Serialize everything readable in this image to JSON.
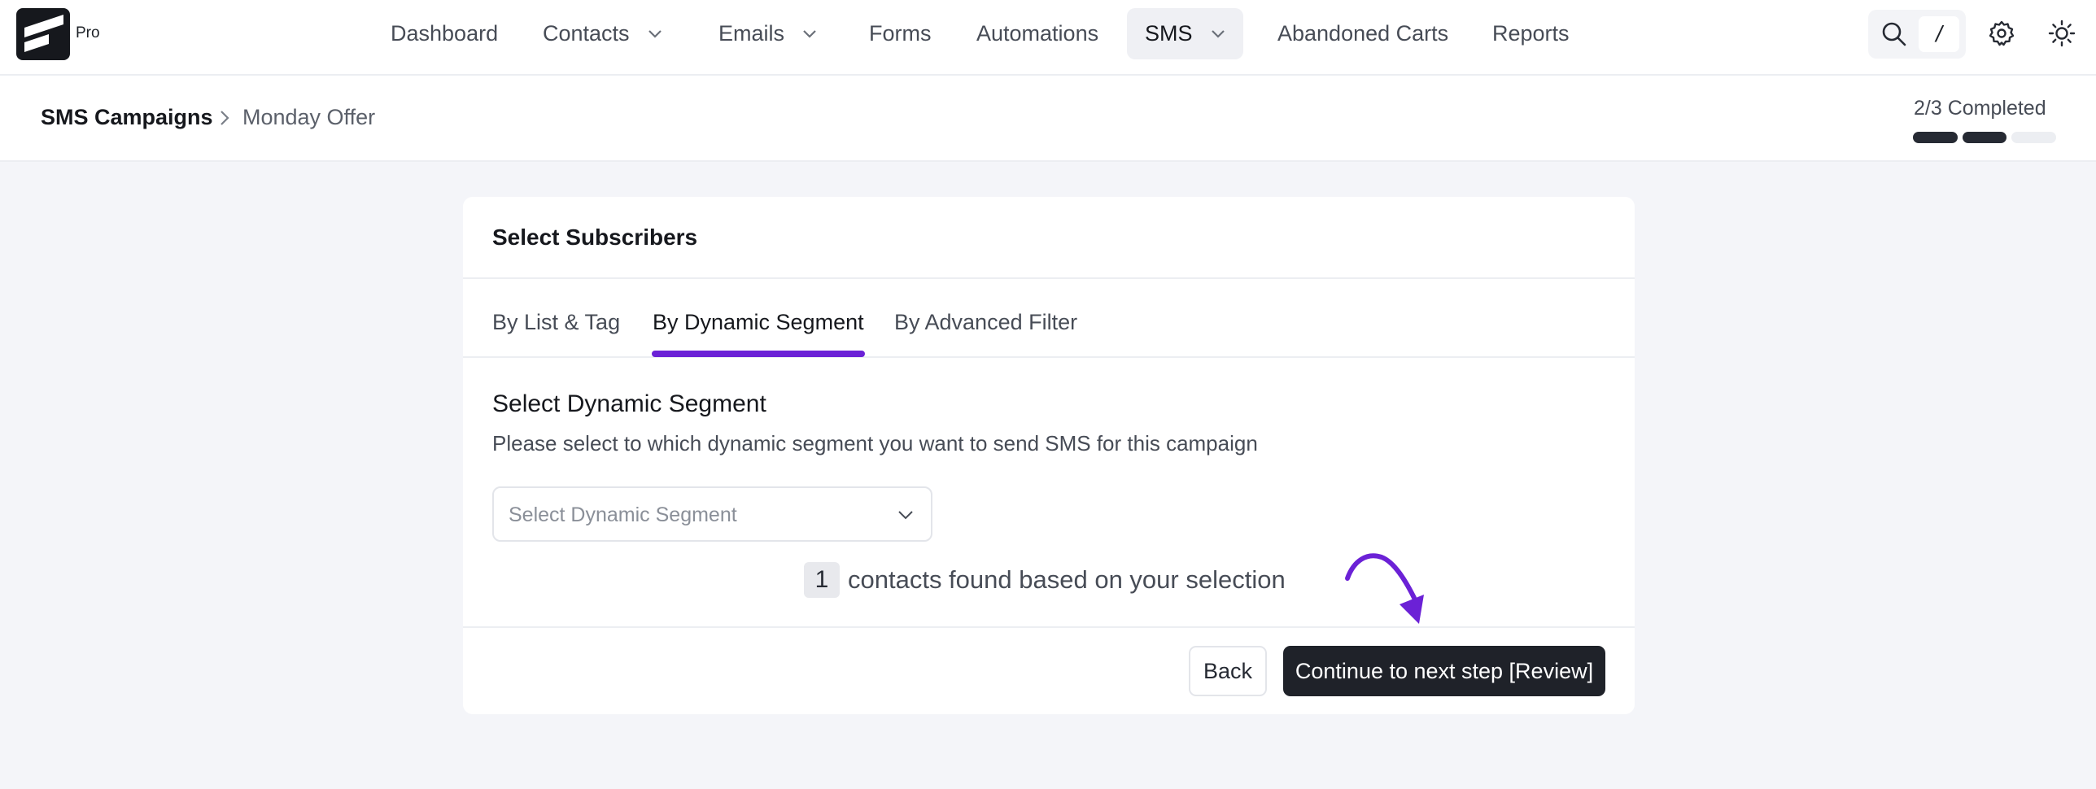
{
  "app": {
    "logo_icon": "fluentcrm-logo-icon",
    "pro_label": "Pro"
  },
  "nav": {
    "items": [
      {
        "label": "Dashboard",
        "dropdown": false
      },
      {
        "label": "Contacts",
        "dropdown": true
      },
      {
        "label": "Emails",
        "dropdown": true
      },
      {
        "label": "Forms",
        "dropdown": false
      },
      {
        "label": "Automations",
        "dropdown": false
      },
      {
        "label": "SMS",
        "dropdown": true,
        "active": true
      },
      {
        "label": "Abandoned Carts",
        "dropdown": false
      },
      {
        "label": "Reports",
        "dropdown": false
      }
    ],
    "search_icon": "search-icon",
    "search_shortcut": "/",
    "settings_icon": "gear-icon",
    "theme_icon": "sun-icon"
  },
  "breadcrumb": {
    "root": "SMS Campaigns",
    "separator_icon": "chevron-right-icon",
    "current": "Monday Offer"
  },
  "progress": {
    "label": "2/3 Completed",
    "completed": 2,
    "total": 3
  },
  "card": {
    "title": "Select Subscribers",
    "tabs": [
      {
        "label": "By List & Tag",
        "active": false
      },
      {
        "label": "By Dynamic Segment",
        "active": true
      },
      {
        "label": "By Advanced Filter",
        "active": false
      }
    ],
    "section_title": "Select Dynamic Segment",
    "section_desc": "Please select to which dynamic segment you want to send SMS for this campaign",
    "select_placeholder": "Select Dynamic Segment",
    "count_value": "1",
    "count_text": "contacts found based on your selection",
    "back_label": "Back",
    "next_label": "Continue to next step [Review]"
  },
  "colors": {
    "accent": "#6b21d6",
    "primary_button": "#1f2229",
    "background": "#f4f5f9"
  }
}
